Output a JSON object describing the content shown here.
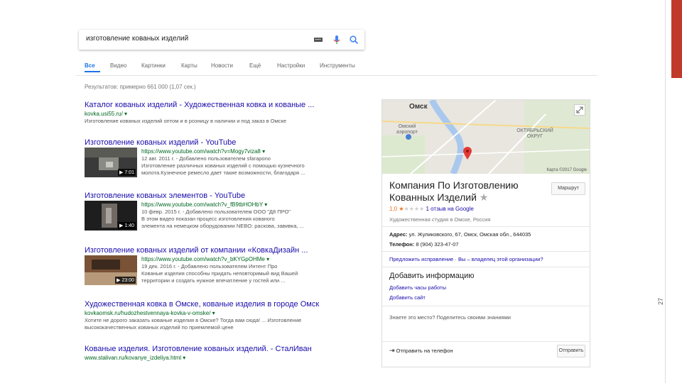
{
  "search": {
    "query": "изготовление кованых изделий"
  },
  "tabs": [
    "Все",
    "Видео",
    "Картинки",
    "Карты",
    "Новости",
    "Ещё",
    "Настройки",
    "Инструменты"
  ],
  "stats": "Результатов: примерно 661 000 (1,07 сек.)",
  "results": [
    {
      "title": "Каталог кованых изделий - Художественная ковка и кованые ...",
      "url": "kovka.usi55.ru/ ▾",
      "snippet": [
        "Изготовление кованых изделий оптом и в розницу в наличии и под заказ в Омске"
      ]
    },
    {
      "title": "Изготовление кованых изделий - YouTube",
      "url": "https://www.youtube.com/watch?v=Mogy7viza8 ▾",
      "snippet": [
        "12 авг. 2011 г. - Добавлено пользователем sfarapono",
        "Изготовление различных кованых изделий с помощью кузнечного",
        "молота.Кузнечное ремесло дает такие возможности, благодаря ..."
      ],
      "duration": "▶ 7:01"
    },
    {
      "title": "Изготовление кованых элементов - YouTube",
      "url": "https://www.youtube.com/watch?v_fB9tbHOHbY ▾",
      "snippet": [
        "10 февр. 2015 г. - Добавлено пользователем ООО \"Д8 ПРО\"",
        "В этом видео показан процесс изготовления кованого",
        "элемента на немецком оборудовании NEBO: раскова, завивка, ..."
      ],
      "duration": "▶ 1:40"
    },
    {
      "title": "Изготовление кованых изделий от компании «КовкаДизайн ...",
      "url": "https://www.youtube.com/watch?v_bKYGpOHMe ▾",
      "snippet": [
        "19 дек. 2016 г. - Добавлено пользователем Интент Про",
        "Кованые изделия способны придать неповторимый вид Вашей",
        "территории и создать нужное впечатление у гостей или ..."
      ],
      "duration": "▶ 23:00"
    },
    {
      "title": "Художественная ковка в Омске, кованые изделия в городе Омск",
      "url": "kovkaomsk.ru/hudozhestvennaya-kovka-v-omske/ ▾",
      "snippet": [
        "Хотите не дорого заказать кованые изделия в Омске? Тогда вам сюда! ... Изготовление",
        "высококачественных кованых изделий по приемлемой цене"
      ]
    },
    {
      "title": "Кованые изделия. Изготовление кованых изделий. - СталИван",
      "url": "www.stalivan.ru/kovanye_izdeliya.html ▾",
      "snippet": []
    }
  ],
  "panel": {
    "map": {
      "city": "Омск",
      "label_left": "Омский аэропорт",
      "label_right": "ОКТЯБРЬСКИЙ ОКРУГ",
      "copyright": "Карта ©2017 Google"
    },
    "title": "Компания По Изготовлению Кованных Изделий",
    "route": "Маршрут",
    "rating_value": "1,0",
    "reviews": "1 отзыв на Google",
    "type": "Художественная студия в Омске, Россия",
    "address_label": "Адрес:",
    "address": "ул. Жуликовского, 67, Омск, Омская обл., 644035",
    "phone_label": "Телефон:",
    "phone": "8 (904) 323-47-07",
    "suggest": "Предложить исправление · Вы – владелец этой организации?",
    "add_info": "Добавить информацию",
    "add_hours": "Добавить часы работы",
    "add_site": "Добавить сайт",
    "know_place": "Знаете это место? Поделитесь своими знаниями",
    "send_phone": "Отправить на телефон",
    "send_btn": "Отправить"
  },
  "slide_number": "27",
  "colors": {
    "link": "#1a0dab",
    "url": "#006621",
    "accent": "#1a73e8",
    "star": "#e7711b",
    "red_bar": "#c0392b"
  }
}
